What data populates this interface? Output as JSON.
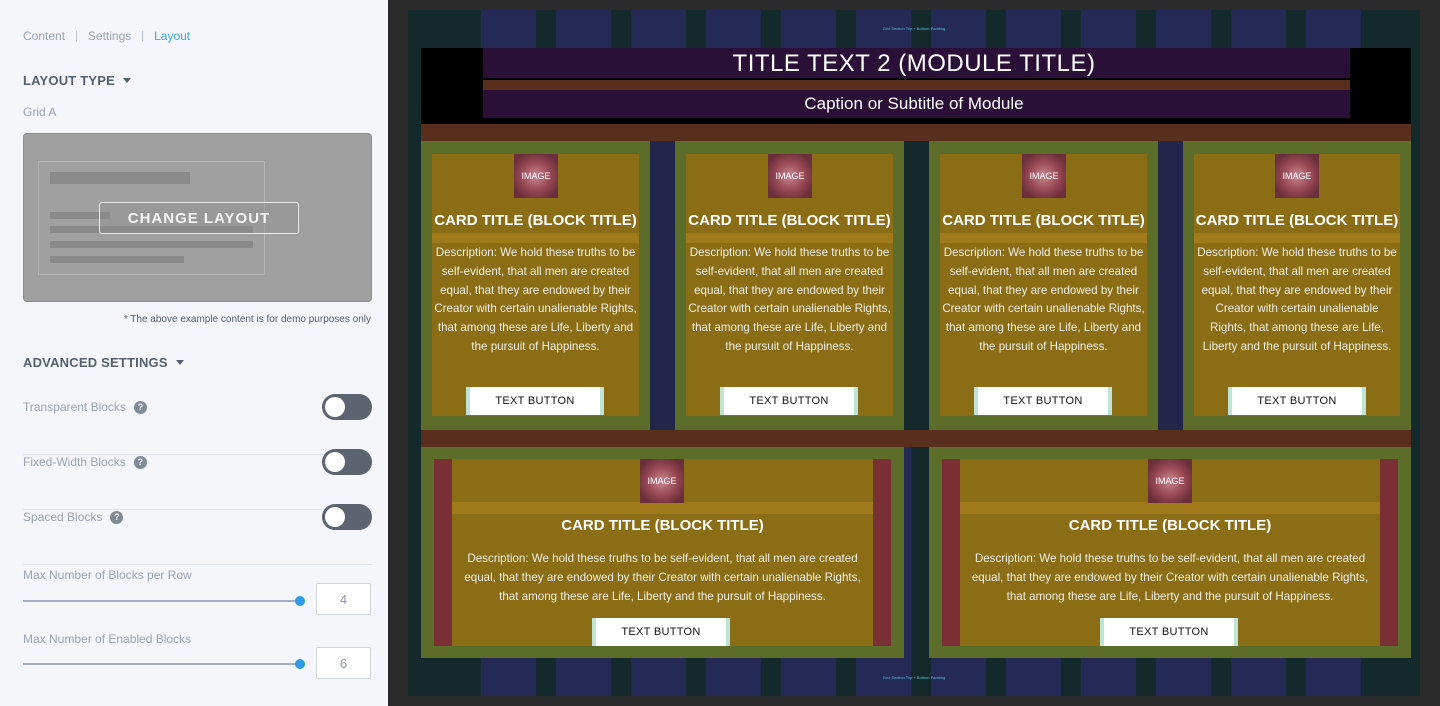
{
  "tabs": [
    {
      "label": "Content"
    },
    {
      "label": "Settings"
    },
    {
      "label": "Layout"
    }
  ],
  "layout": {
    "section_title": "LAYOUT TYPE",
    "type_value": "Grid A",
    "change_button": "CHANGE LAYOUT",
    "demo_note": "* The above example content is for demo purposes only"
  },
  "advanced": {
    "section_title": "ADVANCED SETTINGS",
    "toggles": [
      {
        "label": "Transparent Blocks",
        "help": "?",
        "enabled": false
      },
      {
        "label": "Fixed-Width Blocks",
        "help": "?",
        "enabled": false
      },
      {
        "label": "Spaced Blocks",
        "help": "?",
        "enabled": false
      }
    ],
    "sliders": [
      {
        "label": "Max Number of Blocks per Row",
        "value": "4"
      },
      {
        "label": "Max Number of Enabled Blocks",
        "value": "6"
      }
    ]
  },
  "preview": {
    "top_note": "Grid Section Top + Bottom Padding",
    "bottom_note": "Grid Section Top + Bottom Padding",
    "module_title": "TITLE TEXT 2 (MODULE TITLE)",
    "module_subtitle": "Caption or Subtitle of Module",
    "cards": [
      {
        "image": "IMAGE",
        "title": "CARD TITLE (BLOCK TITLE)",
        "description": "Description: We hold these truths to be self-evident, that all men are created equal, that they are endowed by their Creator with certain unalienable Rights, that among these are Life, Liberty and the pursuit of Happiness.",
        "button": "TEXT BUTTON"
      },
      {
        "image": "IMAGE",
        "title": "CARD TITLE (BLOCK TITLE)",
        "description": "Description: We hold these truths to be self-evident, that all men are created equal, that they are endowed by their Creator with certain unalienable Rights, that among these are Life, Liberty and the pursuit of Happiness.",
        "button": "TEXT BUTTON"
      },
      {
        "image": "IMAGE",
        "title": "CARD TITLE (BLOCK TITLE)",
        "description": "Description: We hold these truths to be self-evident, that all men are created equal, that they are endowed by their Creator with certain unalienable Rights, that among these are Life, Liberty and the pursuit of Happiness.",
        "button": "TEXT BUTTON"
      },
      {
        "image": "IMAGE",
        "title": "CARD TITLE (BLOCK TITLE)",
        "description": "Description: We hold these truths to be self-evident, that all men are created equal, that they are endowed by their Creator with certain unalienable Rights, that among these are Life, Liberty and the pursuit of Happiness.",
        "button": "TEXT BUTTON"
      },
      {
        "image": "IMAGE",
        "title": "CARD TITLE (BLOCK TITLE)",
        "description": "Description: We hold these truths to be self-evident, that all men are created equal, that they are endowed by their Creator with certain unalienable Rights, that among these are Life, Liberty and the pursuit of Happiness.",
        "button": "TEXT BUTTON"
      },
      {
        "image": "IMAGE",
        "title": "CARD TITLE (BLOCK TITLE)",
        "description": "Description: We hold these truths to be self-evident, that all men are created equal, that they are endowed by their Creator with certain unalienable Rights, that among these are Life, Liberty and the pursuit of Happiness.",
        "button": "TEXT BUTTON"
      }
    ]
  },
  "colors": {
    "accent": "#3ea6e6",
    "toggle_off": "#5b6470",
    "slider_thumb": "#2f9ae6",
    "preview_bg": "#2b2b2b",
    "card_outer": "#5b6d29",
    "card_inner": "#8a6d15"
  }
}
